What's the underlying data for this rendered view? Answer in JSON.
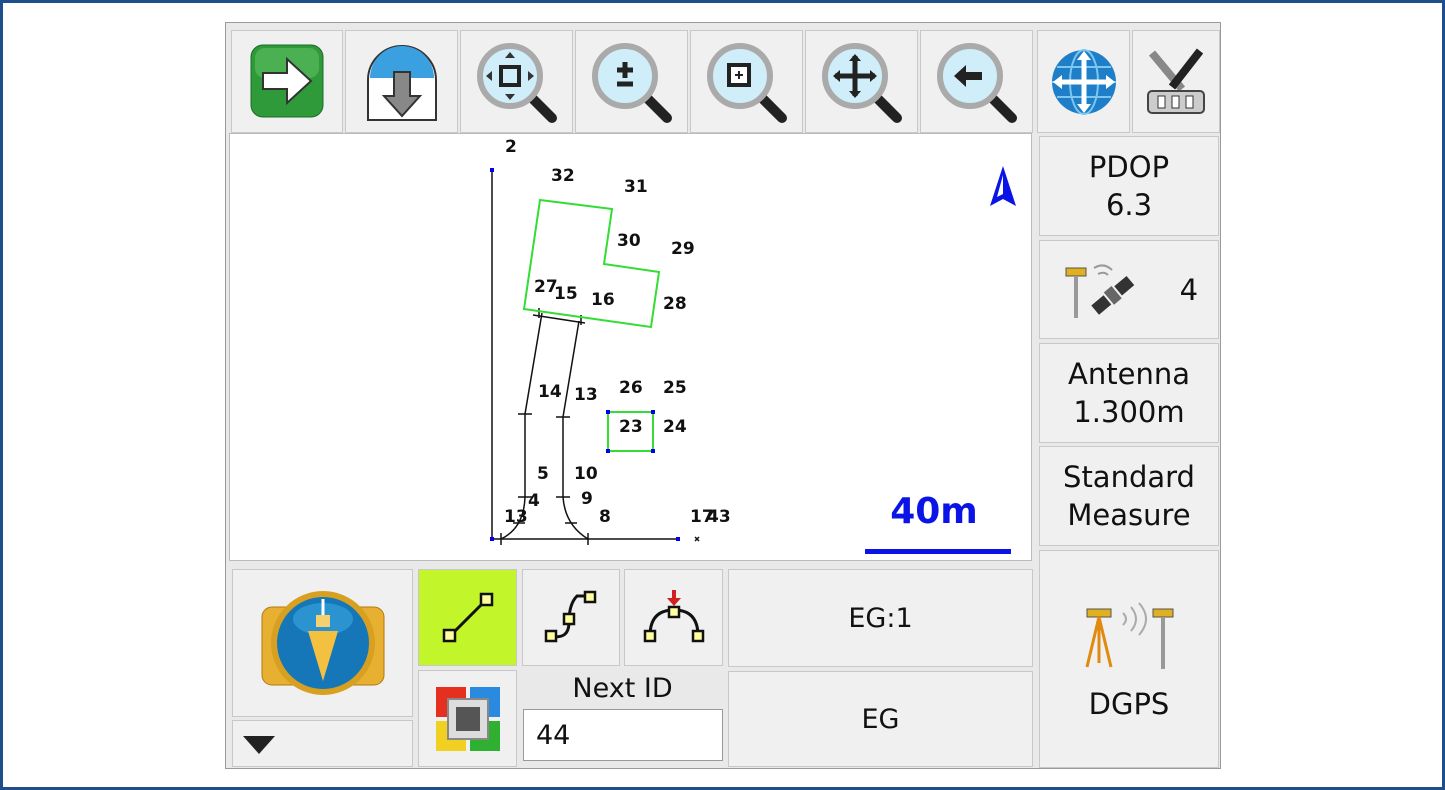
{
  "toolbar": {
    "items": [
      {
        "icon": "green-arrow-right-icon"
      },
      {
        "icon": "globe-download-icon"
      },
      {
        "icon": "zoom-extent-icon"
      },
      {
        "icon": "zoom-in-out-icon"
      },
      {
        "icon": "zoom-window-icon"
      },
      {
        "icon": "zoom-pan-icon"
      },
      {
        "icon": "zoom-previous-icon"
      },
      {
        "icon": "globe-pan-icon"
      },
      {
        "icon": "settings-tools-icon"
      }
    ]
  },
  "map": {
    "labels": [
      "2",
      "32",
      "31",
      "30",
      "29",
      "27",
      "15",
      "16",
      "28",
      "14",
      "13",
      "26",
      "25",
      "23",
      "24",
      "5",
      "10",
      "4",
      "9",
      "13",
      "8",
      "17",
      "43"
    ],
    "scale_label": "40m",
    "north_icon": "north-arrow-icon",
    "colors": {
      "polygon": "#33dd33",
      "point": "#0000ee",
      "scale": "#0a14e6"
    }
  },
  "status": {
    "pdop_label": "PDOP",
    "pdop_value": "6.3",
    "satellites": "4",
    "antenna_label": "Antenna",
    "antenna_value": "1.300m",
    "mode_line1": "Standard",
    "mode_line2": "Measure",
    "gps_mode": "DGPS"
  },
  "bottom": {
    "code_top": "EG:1",
    "code_bottom": "EG",
    "next_id_label": "Next ID",
    "next_id_value": "44",
    "active_tool_color": "#c2f52a"
  }
}
